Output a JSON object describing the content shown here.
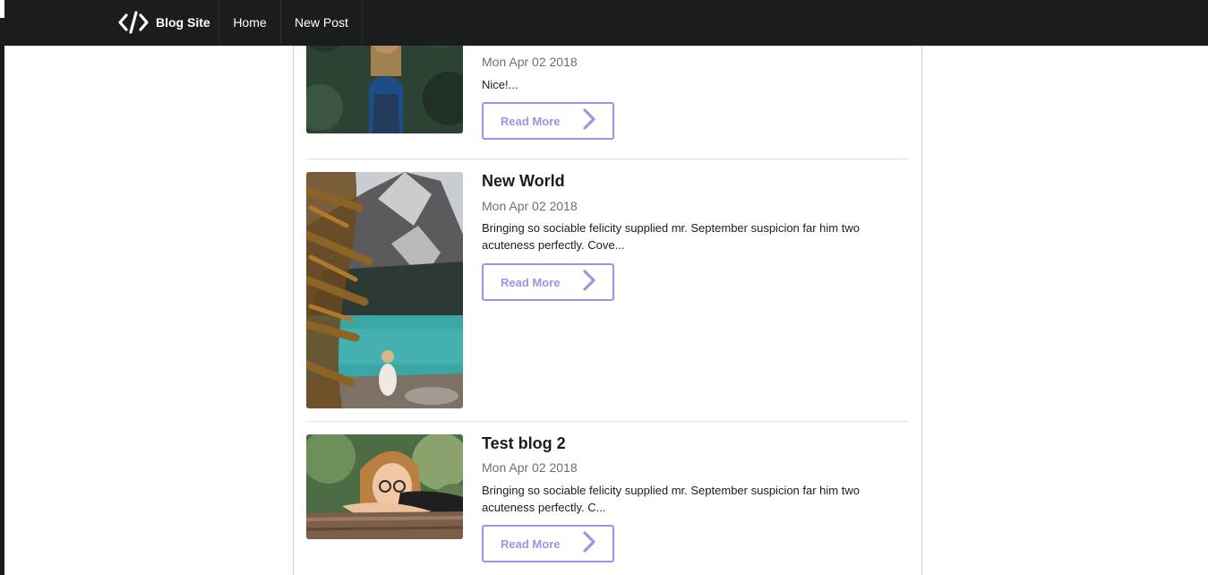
{
  "navbar": {
    "brand": {
      "label": "Blog Site",
      "icon": "code-icon"
    },
    "items": [
      {
        "label": "Home"
      },
      {
        "label": "New Post"
      }
    ]
  },
  "colors": {
    "navbar_bg": "#1b1c1d",
    "accent": "#a291e6",
    "border": "#d4d4d5"
  },
  "posts": [
    {
      "title": "",
      "date": "Mon Apr 02 2018",
      "excerpt": "Nice!...",
      "read_more": "Read More",
      "read_more_icon": "chevron-right-icon"
    },
    {
      "title": "New World",
      "date": "Mon Apr 02 2018",
      "excerpt": "Bringing so sociable felicity supplied mr. September suspicion far him two acuteness perfectly. Cove...",
      "read_more": "Read More",
      "read_more_icon": "chevron-right-icon"
    },
    {
      "title": "Test blog 2",
      "date": "Mon Apr 02 2018",
      "excerpt": "Bringing so sociable felicity supplied mr. September suspicion far him two acuteness perfectly. C...",
      "read_more": "Read More",
      "read_more_icon": "chevron-right-icon"
    }
  ]
}
